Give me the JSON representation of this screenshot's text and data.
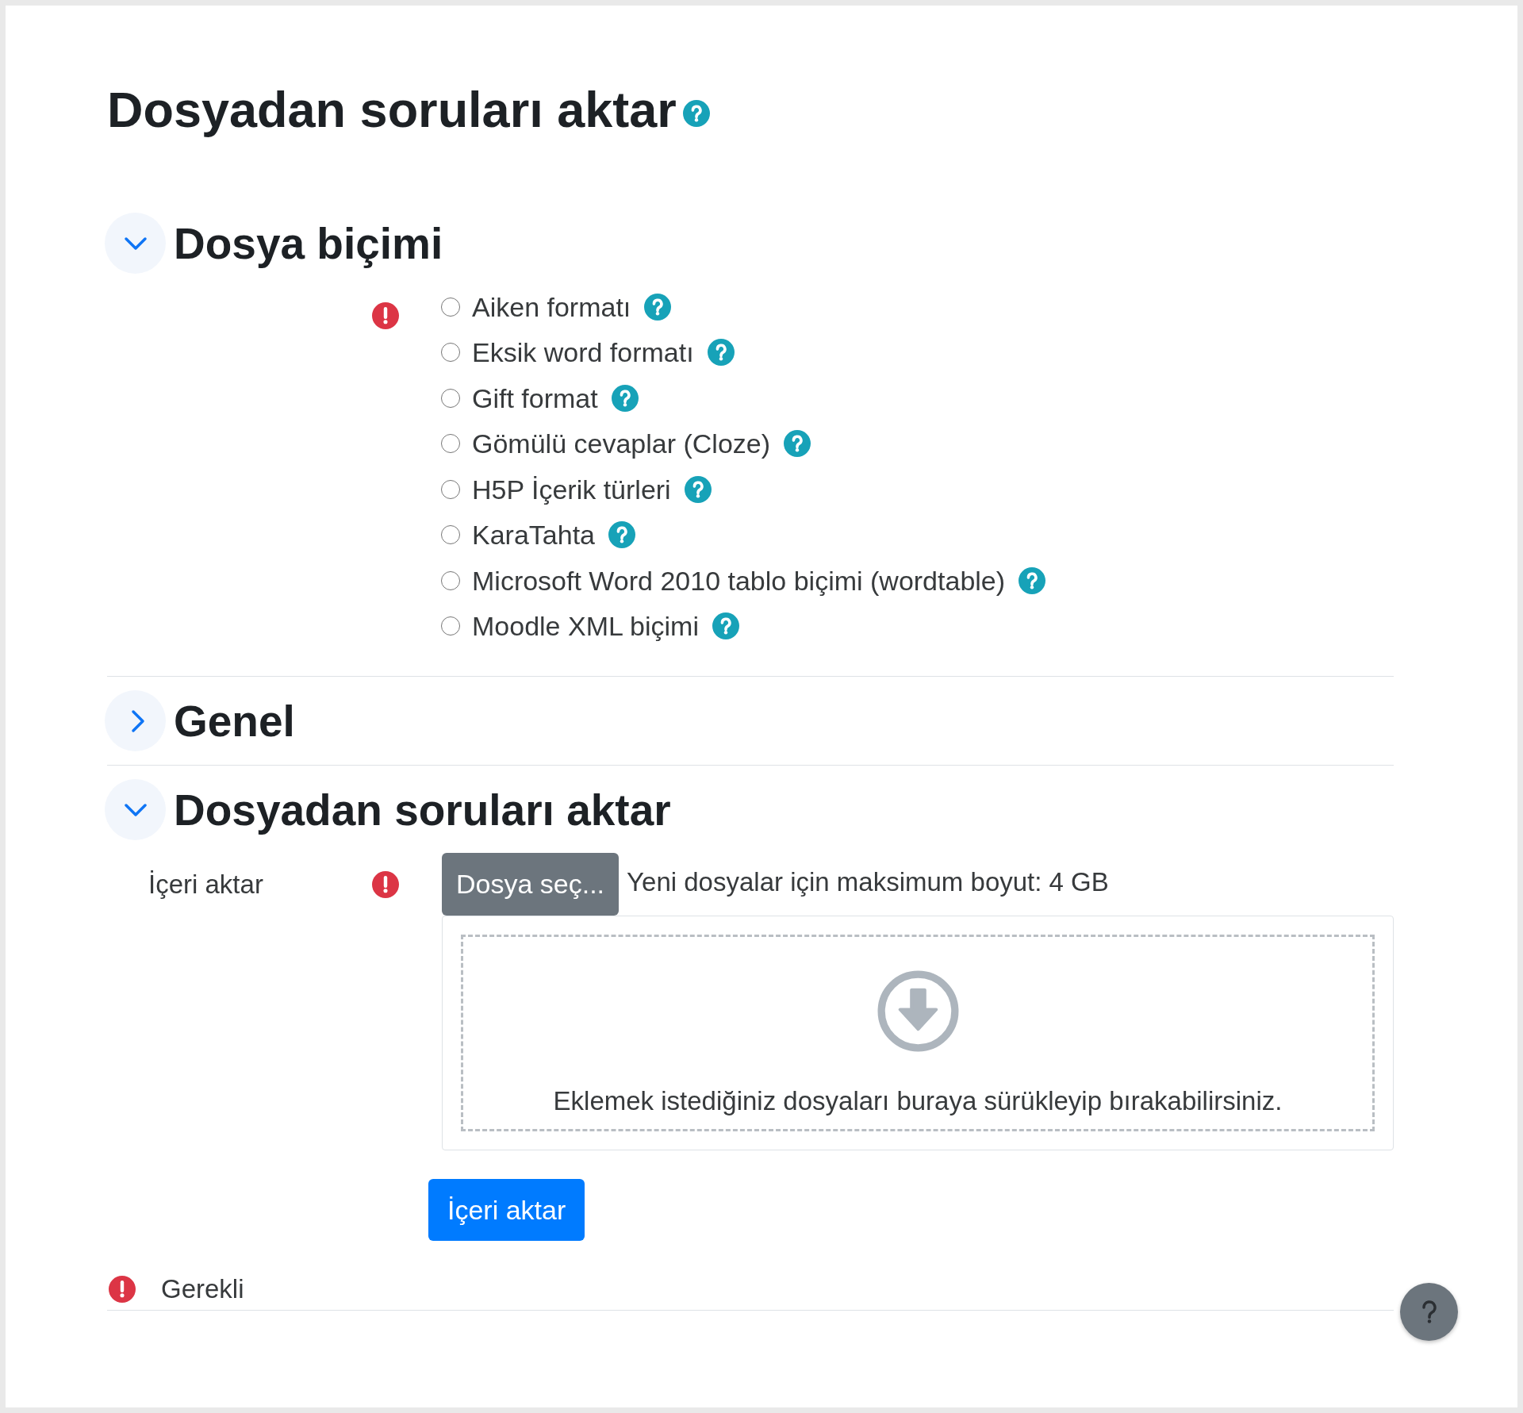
{
  "page": {
    "title": "Dosyadan soruları aktar"
  },
  "sections": [
    {
      "title": "Dosya biçimi",
      "expanded": true,
      "kind": "radios",
      "required": true,
      "options": [
        {
          "label": "Aiken formatı",
          "selected": false
        },
        {
          "label": "Eksik word formatı",
          "selected": false
        },
        {
          "label": "Gift format",
          "selected": false
        },
        {
          "label": "Gömülü cevaplar (Cloze)",
          "selected": false
        },
        {
          "label": "H5P İçerik türleri",
          "selected": false
        },
        {
          "label": "KaraTahta",
          "selected": false
        },
        {
          "label": "Microsoft Word 2010 tablo biçimi (wordtable)",
          "selected": false
        },
        {
          "label": "Moodle XML biçimi",
          "selected": false
        }
      ]
    },
    {
      "title": "Genel",
      "expanded": false
    },
    {
      "title": "Dosyadan soruları aktar",
      "expanded": true,
      "kind": "file",
      "label": "İçeri aktar",
      "required": true,
      "choose_button": "Dosya seç...",
      "max_size": "Yeni dosyalar için maksimum boyut: 4 GB",
      "drop_hint": "Eklemek istediğiniz dosyaları buraya sürükleyip bırakabilirsiniz."
    }
  ],
  "submit_button": "İçeri aktar",
  "required_note": "Gerekli"
}
